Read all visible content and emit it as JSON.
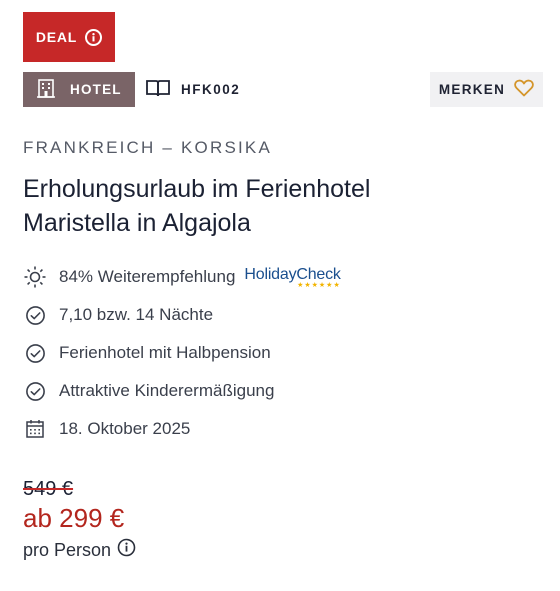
{
  "colors": {
    "accent": "#c62828",
    "hotel_tag_bg": "#7a6467",
    "holidaycheck_blue": "#1a4f8e",
    "star_yellow": "#f2b400",
    "heart_outline": "#d4952a"
  },
  "deal": {
    "label": "DEAL",
    "icon": "info-icon"
  },
  "tags": {
    "hotel": {
      "label": "HOTEL",
      "icon": "building-icon"
    },
    "code": {
      "label": "HFK002",
      "icon": "book-icon"
    }
  },
  "merken": {
    "label": "MERKEN",
    "icon": "heart-outline-icon"
  },
  "region": "FRANKREICH – KORSIKA",
  "title": "Erholungsurlaub im Ferienhotel Maristella in Algajola",
  "features": [
    {
      "icon": "sun-icon",
      "text": "84% Weiterempfehlung",
      "badge": "HolidayCheck"
    },
    {
      "icon": "check-circle-icon",
      "text": "7,10 bzw. 14 Nächte"
    },
    {
      "icon": "check-circle-icon",
      "text": "Ferienhotel mit Halbpension"
    },
    {
      "icon": "check-circle-icon",
      "text": "Attraktive Kinderermäßigung"
    },
    {
      "icon": "calendar-icon",
      "text": "18. Oktober 2025"
    }
  ],
  "price": {
    "old": "549 €",
    "current": "ab 299 €",
    "per": "pro Person",
    "per_icon": "info-icon"
  }
}
